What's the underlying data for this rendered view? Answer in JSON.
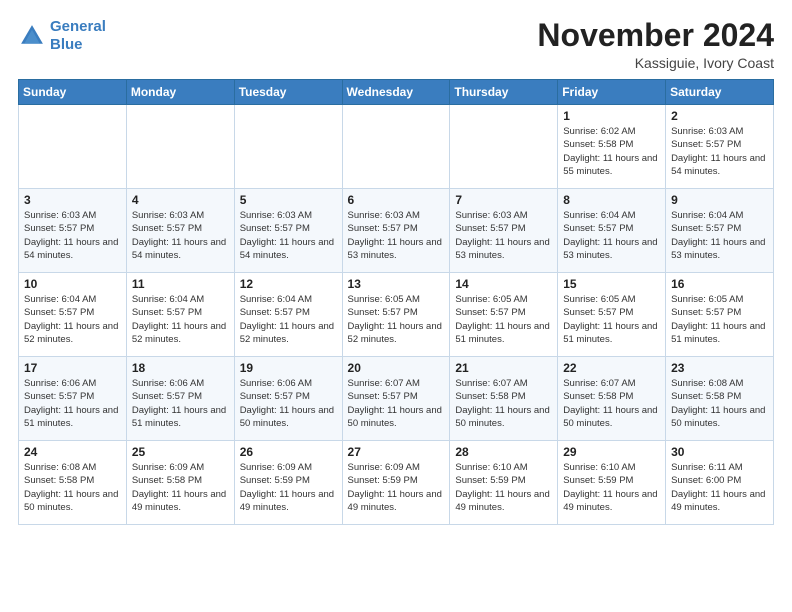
{
  "header": {
    "logo_line1": "General",
    "logo_line2": "Blue",
    "month_title": "November 2024",
    "subtitle": "Kassiguie, Ivory Coast"
  },
  "weekdays": [
    "Sunday",
    "Monday",
    "Tuesday",
    "Wednesday",
    "Thursday",
    "Friday",
    "Saturday"
  ],
  "weeks": [
    [
      {
        "day": "",
        "info": ""
      },
      {
        "day": "",
        "info": ""
      },
      {
        "day": "",
        "info": ""
      },
      {
        "day": "",
        "info": ""
      },
      {
        "day": "",
        "info": ""
      },
      {
        "day": "1",
        "info": "Sunrise: 6:02 AM\nSunset: 5:58 PM\nDaylight: 11 hours and 55 minutes."
      },
      {
        "day": "2",
        "info": "Sunrise: 6:03 AM\nSunset: 5:57 PM\nDaylight: 11 hours and 54 minutes."
      }
    ],
    [
      {
        "day": "3",
        "info": "Sunrise: 6:03 AM\nSunset: 5:57 PM\nDaylight: 11 hours and 54 minutes."
      },
      {
        "day": "4",
        "info": "Sunrise: 6:03 AM\nSunset: 5:57 PM\nDaylight: 11 hours and 54 minutes."
      },
      {
        "day": "5",
        "info": "Sunrise: 6:03 AM\nSunset: 5:57 PM\nDaylight: 11 hours and 54 minutes."
      },
      {
        "day": "6",
        "info": "Sunrise: 6:03 AM\nSunset: 5:57 PM\nDaylight: 11 hours and 53 minutes."
      },
      {
        "day": "7",
        "info": "Sunrise: 6:03 AM\nSunset: 5:57 PM\nDaylight: 11 hours and 53 minutes."
      },
      {
        "day": "8",
        "info": "Sunrise: 6:04 AM\nSunset: 5:57 PM\nDaylight: 11 hours and 53 minutes."
      },
      {
        "day": "9",
        "info": "Sunrise: 6:04 AM\nSunset: 5:57 PM\nDaylight: 11 hours and 53 minutes."
      }
    ],
    [
      {
        "day": "10",
        "info": "Sunrise: 6:04 AM\nSunset: 5:57 PM\nDaylight: 11 hours and 52 minutes."
      },
      {
        "day": "11",
        "info": "Sunrise: 6:04 AM\nSunset: 5:57 PM\nDaylight: 11 hours and 52 minutes."
      },
      {
        "day": "12",
        "info": "Sunrise: 6:04 AM\nSunset: 5:57 PM\nDaylight: 11 hours and 52 minutes."
      },
      {
        "day": "13",
        "info": "Sunrise: 6:05 AM\nSunset: 5:57 PM\nDaylight: 11 hours and 52 minutes."
      },
      {
        "day": "14",
        "info": "Sunrise: 6:05 AM\nSunset: 5:57 PM\nDaylight: 11 hours and 51 minutes."
      },
      {
        "day": "15",
        "info": "Sunrise: 6:05 AM\nSunset: 5:57 PM\nDaylight: 11 hours and 51 minutes."
      },
      {
        "day": "16",
        "info": "Sunrise: 6:05 AM\nSunset: 5:57 PM\nDaylight: 11 hours and 51 minutes."
      }
    ],
    [
      {
        "day": "17",
        "info": "Sunrise: 6:06 AM\nSunset: 5:57 PM\nDaylight: 11 hours and 51 minutes."
      },
      {
        "day": "18",
        "info": "Sunrise: 6:06 AM\nSunset: 5:57 PM\nDaylight: 11 hours and 51 minutes."
      },
      {
        "day": "19",
        "info": "Sunrise: 6:06 AM\nSunset: 5:57 PM\nDaylight: 11 hours and 50 minutes."
      },
      {
        "day": "20",
        "info": "Sunrise: 6:07 AM\nSunset: 5:57 PM\nDaylight: 11 hours and 50 minutes."
      },
      {
        "day": "21",
        "info": "Sunrise: 6:07 AM\nSunset: 5:58 PM\nDaylight: 11 hours and 50 minutes."
      },
      {
        "day": "22",
        "info": "Sunrise: 6:07 AM\nSunset: 5:58 PM\nDaylight: 11 hours and 50 minutes."
      },
      {
        "day": "23",
        "info": "Sunrise: 6:08 AM\nSunset: 5:58 PM\nDaylight: 11 hours and 50 minutes."
      }
    ],
    [
      {
        "day": "24",
        "info": "Sunrise: 6:08 AM\nSunset: 5:58 PM\nDaylight: 11 hours and 50 minutes."
      },
      {
        "day": "25",
        "info": "Sunrise: 6:09 AM\nSunset: 5:58 PM\nDaylight: 11 hours and 49 minutes."
      },
      {
        "day": "26",
        "info": "Sunrise: 6:09 AM\nSunset: 5:59 PM\nDaylight: 11 hours and 49 minutes."
      },
      {
        "day": "27",
        "info": "Sunrise: 6:09 AM\nSunset: 5:59 PM\nDaylight: 11 hours and 49 minutes."
      },
      {
        "day": "28",
        "info": "Sunrise: 6:10 AM\nSunset: 5:59 PM\nDaylight: 11 hours and 49 minutes."
      },
      {
        "day": "29",
        "info": "Sunrise: 6:10 AM\nSunset: 5:59 PM\nDaylight: 11 hours and 49 minutes."
      },
      {
        "day": "30",
        "info": "Sunrise: 6:11 AM\nSunset: 6:00 PM\nDaylight: 11 hours and 49 minutes."
      }
    ]
  ]
}
